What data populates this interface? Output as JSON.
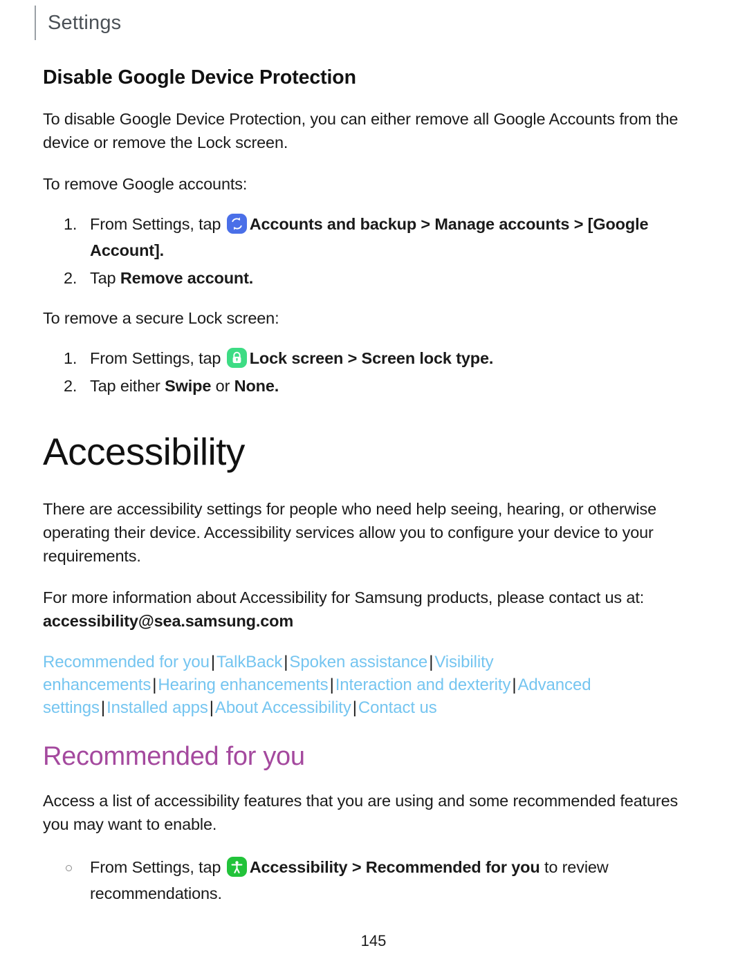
{
  "running_header": {
    "label": "Settings"
  },
  "section_device_protection": {
    "heading": "Disable Google Device Protection",
    "intro": "To disable Google Device Protection, you can either remove all Google Accounts from the device or remove the Lock screen.",
    "lead_accounts": "To remove Google accounts:",
    "steps_accounts": [
      {
        "prefix": "From Settings, tap",
        "icon": "sync-icon",
        "icon_color": "#4a6fe8",
        "bold_1": "Accounts and backup",
        "chevron": " > ",
        "bold_2": "Manage accounts",
        "chevron_2": " > ",
        "bold_3": "[Google Account]."
      },
      {
        "prefix": "Tap",
        "bold_1": "Remove account."
      }
    ],
    "lead_lockscreen": "To remove a secure Lock screen:",
    "steps_lockscreen": [
      {
        "prefix": "From Settings, tap",
        "icon": "lock-icon",
        "icon_color": "#3ddc84",
        "bold_1": "Lock screen",
        "chevron": " > ",
        "bold_2": "Screen lock type."
      },
      {
        "prefix": "Tap either",
        "bold_1": "Swipe",
        "middle": " or ",
        "bold_2": "None."
      }
    ]
  },
  "chapter": {
    "title": "Accessibility",
    "paragraph_1": "There are accessibility settings for people who need help seeing, hearing, or otherwise operating their device. Accessibility services allow you to configure your device to your requirements.",
    "paragraph_2_lead": "For more information about Accessibility for Samsung products, please contact us at:",
    "contact_email": "accessibility@sea.samsung.com"
  },
  "link_row": {
    "separator": "|",
    "link_color": "#75c5f0",
    "links": [
      "Recommended for you",
      "TalkBack",
      "Spoken assistance",
      "Visibility enhancements",
      "Hearing enhancements",
      "Interaction and dexterity",
      "Advanced settings",
      "Installed apps",
      "About Accessibility",
      "Contact us"
    ]
  },
  "section_recommended": {
    "heading": "Recommended for you",
    "heading_color": "#a4499e",
    "paragraph": "Access a list of accessibility features that you are using and some recommended features you may want to enable.",
    "bullet": {
      "prefix": "From Settings, tap",
      "icon": "accessibility-icon",
      "icon_color": "#22c33a",
      "bold_1": "Accessibility",
      "chevron": " > ",
      "bold_2": "Recommended for you",
      "suffix": " to review recommendations."
    }
  },
  "footer": {
    "page_number": "145"
  }
}
